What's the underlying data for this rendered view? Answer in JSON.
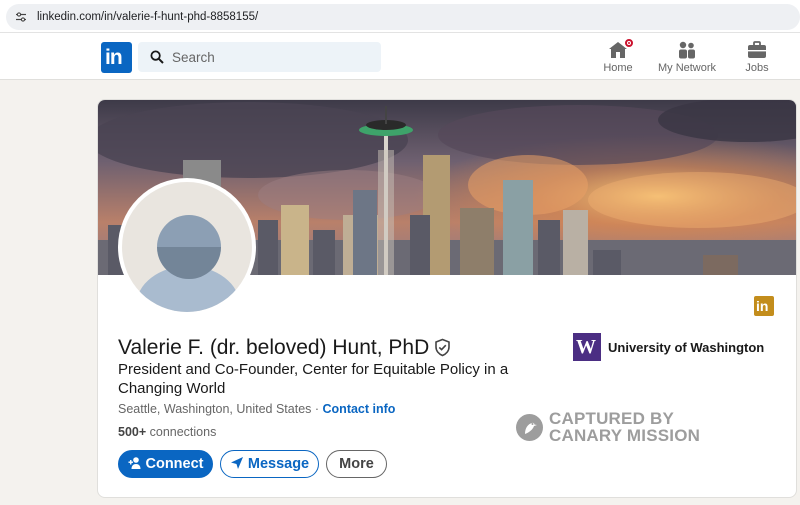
{
  "browser": {
    "url": "linkedin.com/in/valerie-f-hunt-phd-8858155/"
  },
  "nav": {
    "logo_text": "in",
    "search_placeholder": "Search",
    "items": [
      {
        "label": "Home",
        "icon": "home-icon"
      },
      {
        "label": "My Network",
        "icon": "my-network-icon"
      },
      {
        "label": "Jobs",
        "icon": "jobs-icon"
      }
    ]
  },
  "profile": {
    "name": "Valerie F. (dr. beloved) Hunt, PhD",
    "headline": "President and Co-Founder, Center for Equitable Policy in a Changing World",
    "location": "Seattle, Washington, United States",
    "separator": " · ",
    "contact_label": "Contact info",
    "connections_count": "500+",
    "connections_label": " connections",
    "education": {
      "logo_text": "W",
      "name": "University of Washington"
    },
    "premium_icon_text": "in"
  },
  "watermark": {
    "line1": "CAPTURED BY",
    "line2": "CANARY MISSION"
  },
  "actions": {
    "connect": "Connect",
    "message": "Message",
    "more": "More"
  },
  "colors": {
    "linkedin_blue": "#0a66c2",
    "uw_purple": "#4b2e83",
    "premium_gold": "#c38d1c",
    "notification_red": "#cb112d"
  }
}
